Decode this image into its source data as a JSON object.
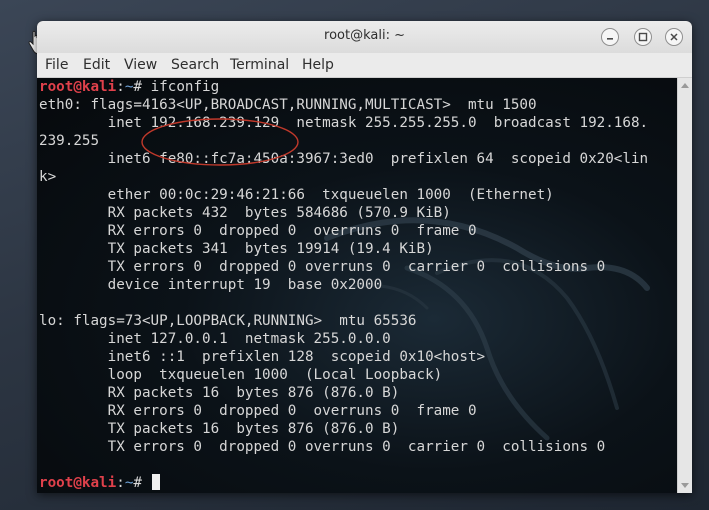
{
  "window": {
    "title": "root@kali: ~"
  },
  "menu": [
    "File",
    "Edit",
    "View",
    "Search",
    "Terminal",
    "Help"
  ],
  "prompt": {
    "user": "root@kali",
    "separator": ":",
    "path": "~",
    "symbol": "# "
  },
  "command": "ifconfig",
  "output": [
    "eth0: flags=4163<UP,BROADCAST,RUNNING,MULTICAST>  mtu 1500",
    "        inet 192.168.239.129  netmask 255.255.255.0  broadcast 192.168.",
    "239.255",
    "        inet6 fe80::fc7a:450a:3967:3ed0  prefixlen 64  scopeid 0x20<lin",
    "k>",
    "        ether 00:0c:29:46:21:66  txqueuelen 1000  (Ethernet)",
    "        RX packets 432  bytes 584686 (570.9 KiB)",
    "        RX errors 0  dropped 0  overruns 0  frame 0",
    "        TX packets 341  bytes 19914 (19.4 KiB)",
    "        TX errors 0  dropped 0 overruns 0  carrier 0  collisions 0",
    "        device interrupt 19  base 0x2000",
    "",
    "lo: flags=73<UP,LOOPBACK,RUNNING>  mtu 65536",
    "        inet 127.0.0.1  netmask 255.0.0.0",
    "        inet6 ::1  prefixlen 128  scopeid 0x10<host>",
    "        loop  txqueuelen 1000  (Local Loopback)",
    "        RX packets 16  bytes 876 (876.0 B)",
    "        RX errors 0  dropped 0  overruns 0  frame 0",
    "        TX packets 16  bytes 876 (876.0 B)",
    "        TX errors 0  dropped 0 overruns 0  carrier 0  collisions 0",
    ""
  ],
  "colors": {
    "prompt_user": "#e0414b",
    "prompt_path": "#6fa3d9",
    "annotation": "#c0392b"
  }
}
